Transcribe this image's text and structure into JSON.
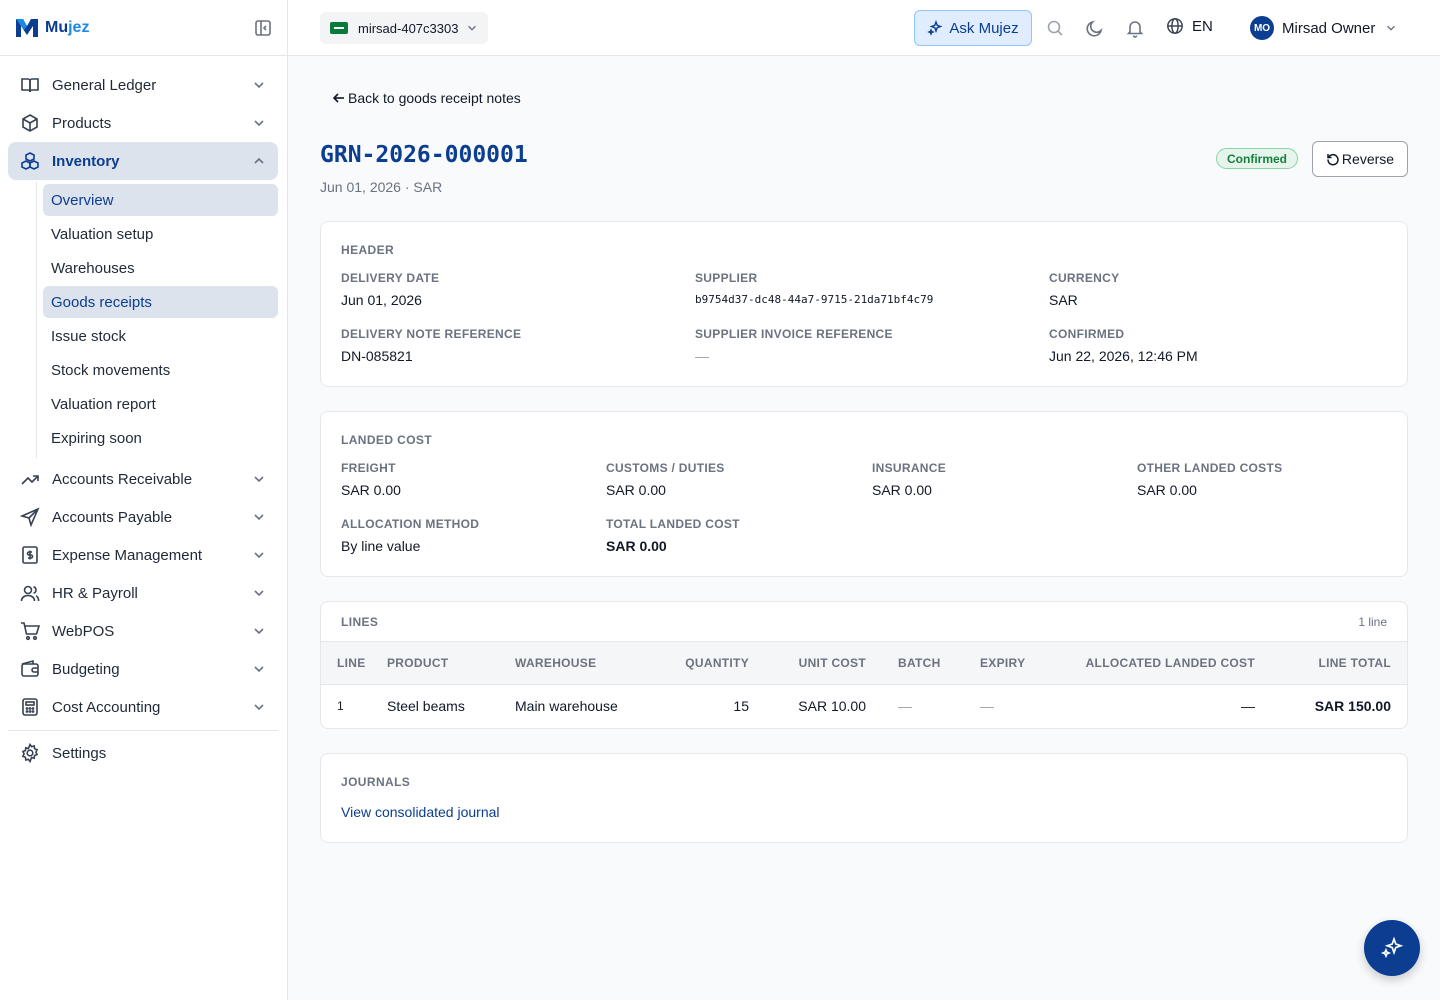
{
  "brand": {
    "name_part1": "Mu",
    "name_part2": "jez"
  },
  "sidebar": {
    "items": [
      {
        "label": "General Ledger",
        "icon": "book-icon"
      },
      {
        "label": "Products",
        "icon": "box-icon"
      },
      {
        "label": "Inventory",
        "icon": "cubes-icon"
      },
      {
        "label": "Accounts Receivable",
        "icon": "trend-up-icon"
      },
      {
        "label": "Accounts Payable",
        "icon": "send-icon"
      },
      {
        "label": "Expense Management",
        "icon": "receipt-dollar-icon"
      },
      {
        "label": "HR & Payroll",
        "icon": "users-icon"
      },
      {
        "label": "WebPOS",
        "icon": "cart-icon"
      },
      {
        "label": "Budgeting",
        "icon": "wallet-icon"
      },
      {
        "label": "Cost Accounting",
        "icon": "calculator-icon"
      },
      {
        "label": "Settings",
        "icon": "gear-icon"
      }
    ],
    "inventory_sub": [
      "Overview",
      "Valuation setup",
      "Warehouses",
      "Goods receipts",
      "Issue stock",
      "Stock movements",
      "Valuation report",
      "Expiring soon"
    ]
  },
  "topbar": {
    "org": "mirsad-407c3303",
    "ask": "Ask Mujez",
    "lang": "EN",
    "user_initials": "MO",
    "user_name": "Mirsad Owner"
  },
  "page": {
    "back": "Back to goods receipt notes",
    "title": "GRN-2026-000001",
    "subtitle": "Jun 01, 2026 · SAR",
    "status": "Confirmed",
    "status_color": "#15803d",
    "reverse": "Reverse"
  },
  "header": {
    "title": "HEADER",
    "delivery_date_label": "DELIVERY DATE",
    "delivery_date": "Jun 01, 2026",
    "supplier_label": "SUPPLIER",
    "supplier": "b9754d37-dc48-44a7-9715-21da71bf4c79",
    "currency_label": "CURRENCY",
    "currency": "SAR",
    "dn_ref_label": "DELIVERY NOTE REFERENCE",
    "dn_ref": "DN-085821",
    "sup_inv_label": "SUPPLIER INVOICE REFERENCE",
    "sup_inv": "—",
    "confirmed_label": "CONFIRMED",
    "confirmed": "Jun 22, 2026, 12:46 PM"
  },
  "landed": {
    "title": "LANDED COST",
    "freight_label": "FREIGHT",
    "freight": "SAR 0.00",
    "customs_label": "CUSTOMS / DUTIES",
    "customs": "SAR 0.00",
    "insurance_label": "INSURANCE",
    "insurance": "SAR 0.00",
    "other_label": "OTHER LANDED COSTS",
    "other": "SAR 0.00",
    "method_label": "ALLOCATION METHOD",
    "method": "By line value",
    "total_label": "TOTAL LANDED COST",
    "total": "SAR 0.00"
  },
  "lines": {
    "title": "LINES",
    "count": "1 line",
    "columns": [
      "LINE",
      "PRODUCT",
      "WAREHOUSE",
      "QUANTITY",
      "UNIT COST",
      "BATCH",
      "EXPIRY",
      "ALLOCATED LANDED COST",
      "LINE TOTAL"
    ],
    "rows": [
      {
        "line": "1",
        "product": "Steel beams",
        "warehouse": "Main warehouse",
        "quantity": "15",
        "unit_cost": "SAR 10.00",
        "batch": "—",
        "expiry": "—",
        "allocated": "—",
        "total": "SAR 150.00"
      }
    ]
  },
  "journals": {
    "title": "JOURNALS",
    "link": "View consolidated journal"
  },
  "colors": {
    "brand": "#0b3d91",
    "accent": "#1e88e5",
    "active_bg": "#dde3ec"
  }
}
